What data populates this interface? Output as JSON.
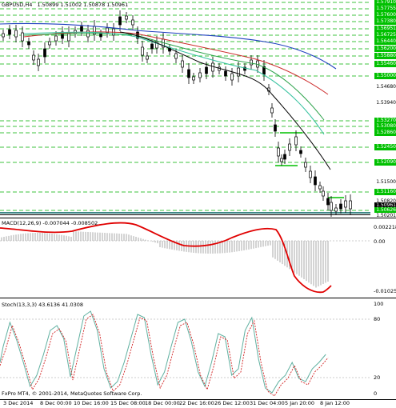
{
  "chart_header": {
    "title": "GBPUSD,H4",
    "values": "1.50899 1.51002 1.50878 1.50961"
  },
  "price_axis": {
    "labels": [
      {
        "v": "1.57910",
        "style": "g"
      },
      {
        "v": "1.57755",
        "style": "g"
      },
      {
        "v": "1.57600",
        "style": "g"
      },
      {
        "v": "1.57380",
        "style": "g"
      },
      {
        "v": "1.56951",
        "style": "g"
      },
      {
        "v": "1.56725",
        "style": "g"
      },
      {
        "v": "1.56440",
        "style": "g"
      },
      {
        "v": "1.56200",
        "style": "g"
      },
      {
        "v": "1.55880",
        "style": "g"
      },
      {
        "v": "1.55460",
        "style": "g"
      },
      {
        "v": "1.55000",
        "style": "g"
      },
      {
        "v": "1.54680",
        "style": "n"
      },
      {
        "v": "1.53940",
        "style": "n"
      },
      {
        "v": "1.53270",
        "style": "g"
      },
      {
        "v": "1.53080",
        "style": "g"
      },
      {
        "v": "1.52860",
        "style": "g"
      },
      {
        "v": "1.52450",
        "style": "g"
      },
      {
        "v": "1.52090",
        "style": "g"
      },
      {
        "v": "1.51500",
        "style": "n"
      },
      {
        "v": "1.51160",
        "style": "g"
      },
      {
        "v": "1.50820",
        "style": "n"
      },
      {
        "v": "1.50961",
        "style": "k"
      },
      {
        "v": "1.50626",
        "style": "g"
      },
      {
        "v": "1.50201",
        "style": "n"
      }
    ]
  },
  "macd": {
    "title": "MACD(12,26,9) -0.007044 -0.008502",
    "axis": [
      "0.002218",
      "0.00",
      "-0.010253"
    ]
  },
  "stoch": {
    "title": "Stoch(13,3,3) 43.6136 41.0308",
    "axis": [
      "100",
      "80",
      "20",
      "0"
    ]
  },
  "copyright": "FxPro MT4, © 2001-2014, MetaQuotes Software Corp.",
  "time_axis": [
    "3 Dec 2014",
    "8 Dec 00:00",
    "10 Dec 16:00",
    "15 Dec 08:00",
    "18 Dec 00:00",
    "22 Dec 16:00",
    "26 Dec 12:00",
    "31 Dec 04:00",
    "5 Jan 20:00",
    "8 Jan 12:00"
  ],
  "colors": {
    "candle": "#000000",
    "ma_blue": "#1f3fbf",
    "ma_red": "#cc2b2b",
    "ma_green": "#2ca24a",
    "ma_teal": "#38c2a0",
    "grid_green": "#00b000",
    "macd_signal": "#e00000",
    "stoch_main": "#2e8b57",
    "stoch_signal": "#d02020"
  }
}
